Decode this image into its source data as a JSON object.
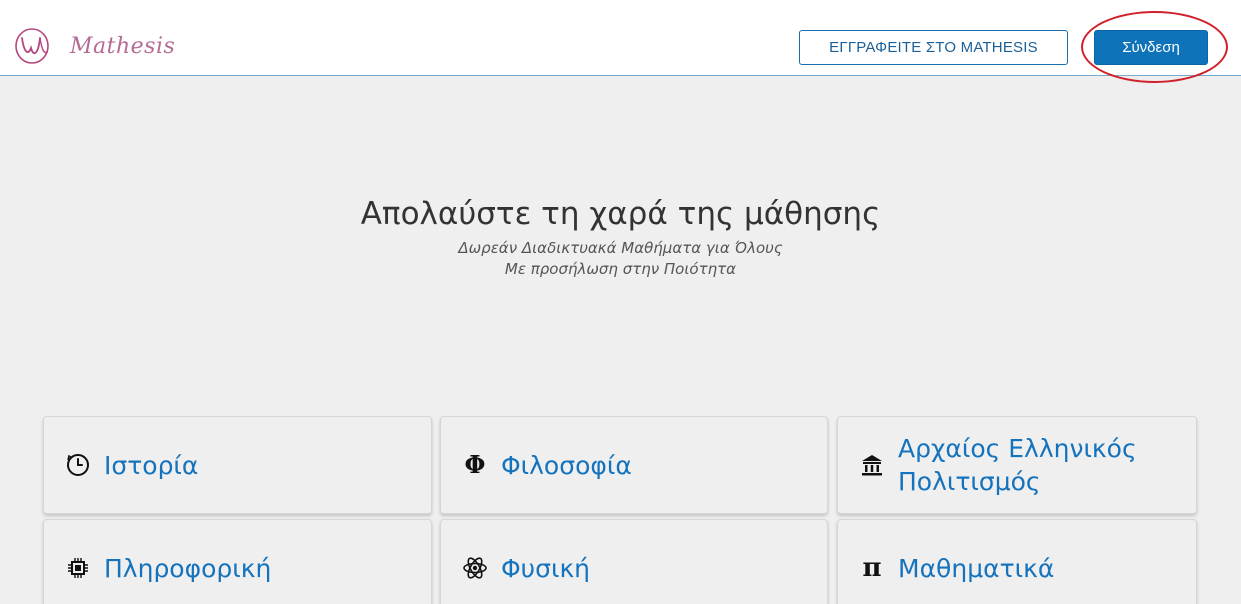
{
  "header": {
    "logo_text": "Mathesis",
    "register_label": "ΕΓΓΡΑΦΕΙΤΕ ΣΤΟ MATHESIS",
    "login_label": "Σύνδεση"
  },
  "hero": {
    "title": "Απολαύστε τη χαρά της μάθησης",
    "subtitle_line1": "Δωρεάν Διαδικτυακά Μαθήματα για Όλους",
    "subtitle_line2": "Με προσήλωση στην Ποιότητα"
  },
  "categories": [
    {
      "label": "Ιστορία",
      "icon": "clock-icon"
    },
    {
      "label": "Φιλοσοφία",
      "icon": "phi-icon"
    },
    {
      "label": "Αρχαίος Ελληνικός Πολιτισμός",
      "icon": "temple-icon"
    },
    {
      "label": "Πληροφορική",
      "icon": "chip-icon"
    },
    {
      "label": "Φυσική",
      "icon": "atom-icon"
    },
    {
      "label": "Μαθηματικά",
      "icon": "pi-icon"
    }
  ],
  "colors": {
    "accent": "#0f73b9",
    "link": "#1573bd",
    "logo": "#b46c95",
    "highlight": "#d0202a",
    "background": "#efefef"
  }
}
